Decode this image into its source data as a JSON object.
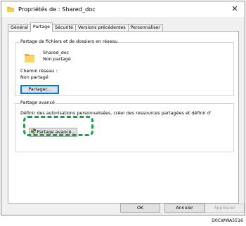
{
  "window": {
    "title": "Propriétés de : Shared_doc",
    "close_glyph": "✕"
  },
  "tabs": [
    {
      "label": "Général",
      "active": false
    },
    {
      "label": "Partage",
      "active": true
    },
    {
      "label": "Sécurité",
      "active": false
    },
    {
      "label": "Versions précédentes",
      "active": false
    },
    {
      "label": "Personnaliser",
      "active": false
    }
  ],
  "network_share": {
    "legend": "Partage de fichiers et de dossiers en réseau",
    "name": "Shared_doc",
    "status": "Non partagé",
    "path_label": "Chemin réseau :",
    "path_value": "Non partagé",
    "share_button": "Partager..."
  },
  "advanced": {
    "legend": "Partage avancé",
    "description": "Définir des autorisations personnalisées, créer des ressources partagées et définir d'",
    "button": "Partage avancé..."
  },
  "footer": {
    "ok": "OK",
    "cancel": "Annuler",
    "apply": "Appliquer"
  },
  "watermark": "D0CWWA5516",
  "colors": {
    "highlight": "#16a34a",
    "focus": "#0078d7"
  }
}
